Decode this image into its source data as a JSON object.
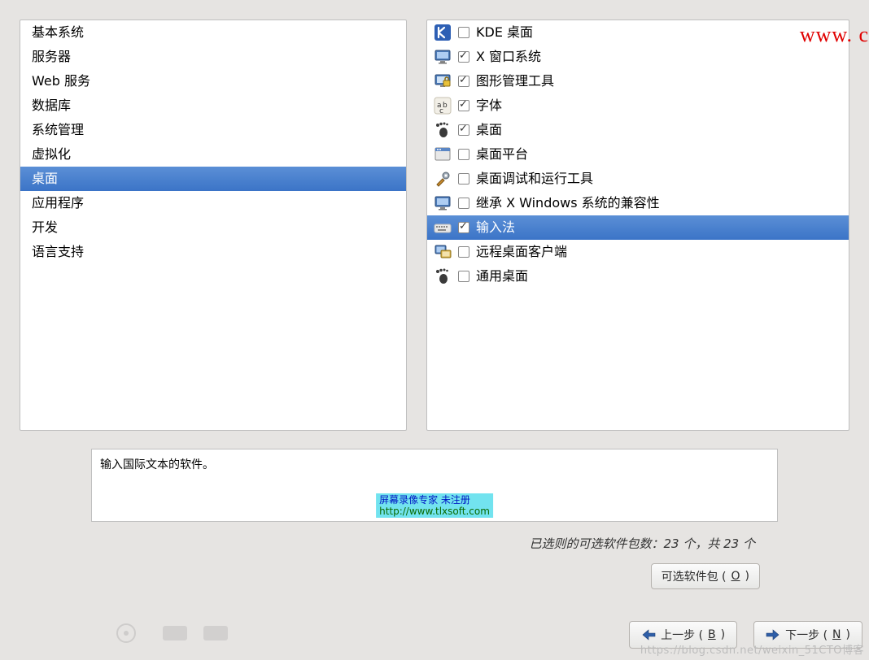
{
  "watermark": "www. c",
  "categories": [
    {
      "label": "基本系统",
      "selected": false
    },
    {
      "label": "服务器",
      "selected": false
    },
    {
      "label": "Web 服务",
      "selected": false
    },
    {
      "label": "数据库",
      "selected": false
    },
    {
      "label": "系统管理",
      "selected": false
    },
    {
      "label": "虚拟化",
      "selected": false
    },
    {
      "label": "桌面",
      "selected": true
    },
    {
      "label": "应用程序",
      "selected": false
    },
    {
      "label": "开发",
      "selected": false
    },
    {
      "label": "语言支持",
      "selected": false
    }
  ],
  "packages": [
    {
      "icon": "kde",
      "label": "KDE 桌面",
      "checked": false,
      "selected": false
    },
    {
      "icon": "monitor",
      "label": "X 窗口系统",
      "checked": true,
      "selected": false
    },
    {
      "icon": "lock-monitor",
      "label": "图形管理工具",
      "checked": true,
      "selected": false
    },
    {
      "icon": "font",
      "label": "字体",
      "checked": true,
      "selected": false
    },
    {
      "icon": "gnome-foot",
      "label": "桌面",
      "checked": true,
      "selected": false
    },
    {
      "icon": "window",
      "label": "桌面平台",
      "checked": false,
      "selected": false
    },
    {
      "icon": "tools",
      "label": "桌面调试和运行工具",
      "checked": false,
      "selected": false
    },
    {
      "icon": "monitor",
      "label": "继承 X Windows 系统的兼容性",
      "checked": false,
      "selected": false
    },
    {
      "icon": "keyboard",
      "label": "输入法",
      "checked": true,
      "selected": true
    },
    {
      "icon": "remote",
      "label": "远程桌面客户端",
      "checked": false,
      "selected": false
    },
    {
      "icon": "gnome-foot",
      "label": "通用桌面",
      "checked": false,
      "selected": false
    }
  ],
  "description": "输入国际文本的软件。",
  "overlay": {
    "line1": "屏幕录像专家      未注册",
    "line2": "http://www.tlxsoft.com"
  },
  "count_line": "已选则的可选软件包数：23 个，共 23 个",
  "buttons": {
    "optional": "可选软件包 (",
    "optional_u": "O",
    "optional_end": ")",
    "back": "上一步 (",
    "back_u": "B",
    "back_end": ")",
    "next": "下一步 (",
    "next_u": "N",
    "next_end": ")"
  },
  "blog_wm": "https://blog.csdn.net/weixin_51CTO博客"
}
